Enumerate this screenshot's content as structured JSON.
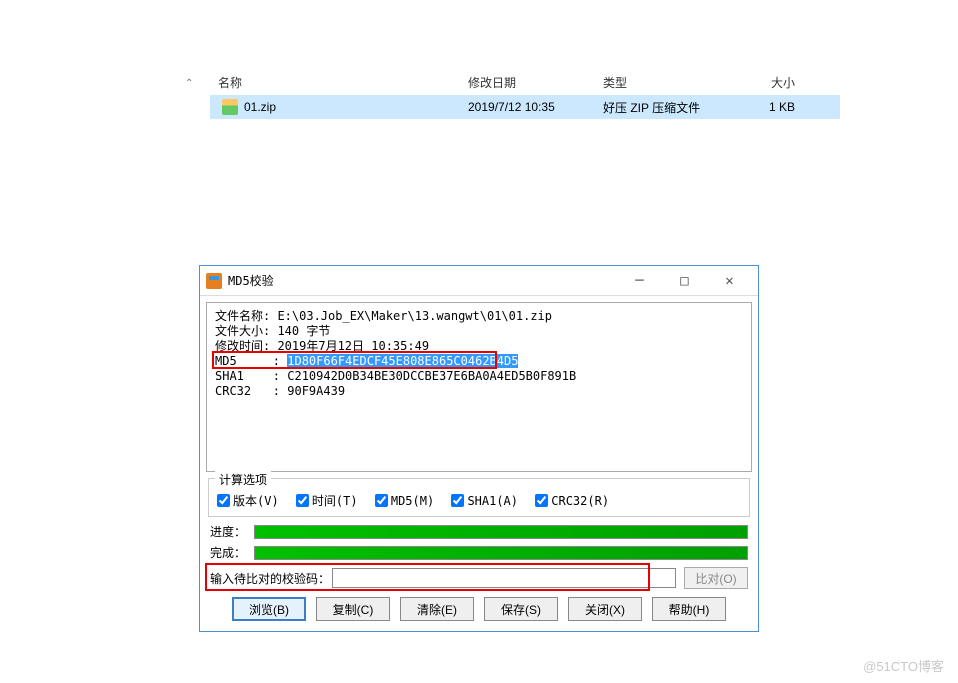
{
  "watermark": "@51CTO博客",
  "fileList": {
    "headers": {
      "name": "名称",
      "date": "修改日期",
      "type": "类型",
      "size": "大小"
    },
    "row": {
      "name": "01.zip",
      "date": "2019/7/12 10:35",
      "type": "好压 ZIP 压缩文件",
      "size": "1 KB"
    }
  },
  "dialog": {
    "title": "MD5校验",
    "info": {
      "filenameLabel": "文件名称: ",
      "filename": "E:\\03.Job_EX\\Maker\\13.wangwt\\01\\01.zip",
      "sizeLabel": "文件大小: ",
      "size": "140 字节",
      "mtimeLabel": "修改时间: ",
      "mtime": "2019年7月12日 10:35:49",
      "md5Label": "MD5     : ",
      "md5": "1D80F66F4EDCF45E808E865C0462B4D5",
      "sha1Label": "SHA1    : ",
      "sha1": "C210942D0B34BE30DCCBE37E6BA0A4ED5B0F891B",
      "crc32Label": "CRC32   : ",
      "crc32": "90F9A439"
    },
    "options": {
      "title": "计算选项",
      "version": "版本(V)",
      "time": "时间(T)",
      "md5": "MD5(M)",
      "sha1": "SHA1(A)",
      "crc32": "CRC32(R)"
    },
    "progress": {
      "progLabel": "进度：",
      "doneLabel": "完成："
    },
    "compare": {
      "label": "输入待比对的校验码：",
      "btn": "比对(O)"
    },
    "buttons": {
      "browse": "浏览(B)",
      "copy": "复制(C)",
      "clear": "清除(E)",
      "save": "保存(S)",
      "close": "关闭(X)",
      "help": "帮助(H)"
    }
  }
}
